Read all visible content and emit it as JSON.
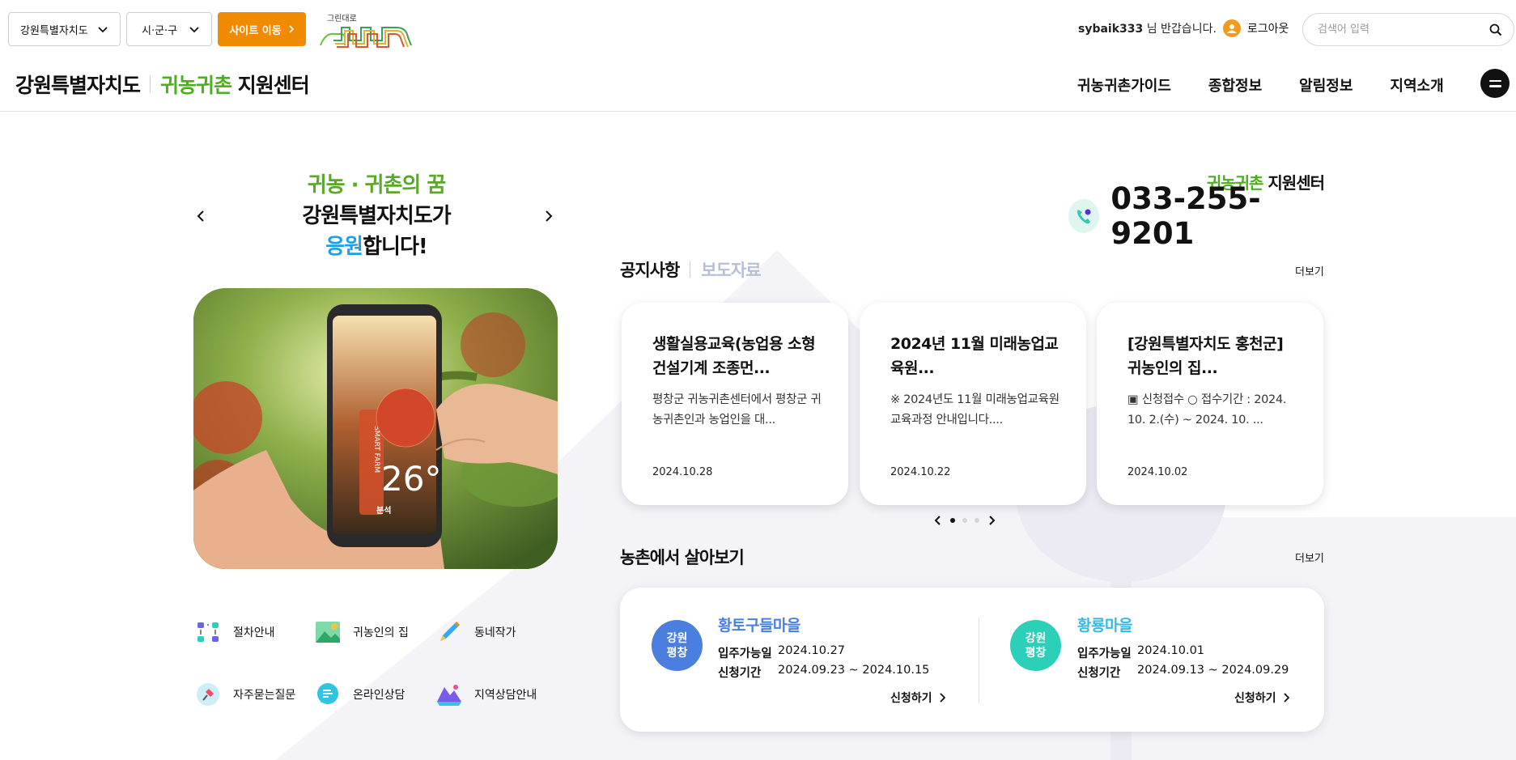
{
  "topbar": {
    "region_select": "강원특별자치도",
    "district_select": "시·군·구",
    "site_move_button": "사이트 이동",
    "greenroad_logo_text": "그린대로",
    "user_name": "sybaik333",
    "user_greeting": "님 반갑습니다.",
    "logout": "로그아웃",
    "search_placeholder": "검색어 입력"
  },
  "header": {
    "brand_region": "강원특별자치도",
    "brand_green": "귀농귀촌",
    "brand_rest": "지원센터",
    "nav": [
      "귀농귀촌가이드",
      "종합정보",
      "알림정보",
      "지역소개"
    ]
  },
  "hero": {
    "line1": "귀농 · 귀촌의 꿈",
    "line2": "강원특별자치도가",
    "line3_blue": "응원",
    "line3_rest": "합니다!",
    "image_label": "SMART FARM",
    "image_temp": "26°",
    "image_caption": "분석"
  },
  "quick_links": [
    "절차안내",
    "귀농인의 집",
    "동네작가",
    "자주묻는질문",
    "온라인상담",
    "지역상담안내"
  ],
  "contact": {
    "label_green": "귀농귀촌",
    "label_rest": "지원센터",
    "phone": "033-255-9201"
  },
  "notices": {
    "tab_active": "공지사항",
    "tab_inactive": "보도자료",
    "more": "더보기",
    "cards": [
      {
        "title": "생활실용교육(농업용 소형건설기계 조종먼...",
        "desc": "평창군 귀농귀촌센터에서 평창군 귀농귀촌인과 농업인을 대...",
        "date": "2024.10.28"
      },
      {
        "title": "2024년 11월 미래농업교육원...",
        "desc": "※ 2024년도 11월 미래농업교육원 교육과정 안내입니다....",
        "date": "2024.10.22"
      },
      {
        "title": "[강원특별자치도 홍천군] 귀농인의 집...",
        "desc": "▣ 신청접수 ○ 접수기간 : 2024. 10. 2.(수) ~ 2024. 10. ...",
        "date": "2024.10.02"
      }
    ]
  },
  "villages": {
    "title": "농촌에서 살아보기",
    "more": "더보기",
    "items": [
      {
        "badge_line1": "강원",
        "badge_line2": "평창",
        "name": "황토구들마을",
        "label_move": "입주가능일",
        "move_date": "2024.10.27",
        "label_period": "신청기간",
        "period": "2024.09.23 ~ 2024.10.15",
        "apply": "신청하기",
        "badge_color": "#4a7fe0",
        "name_color": "#4a7fe0"
      },
      {
        "badge_line1": "강원",
        "badge_line2": "평창",
        "name": "황룡마을",
        "label_move": "입주가능일",
        "move_date": "2024.10.01",
        "label_period": "신청기간",
        "period": "2024.09.13 ~ 2024.09.29",
        "apply": "신청하기",
        "badge_color": "#2ccfb8",
        "name_color": "#37b8e0"
      }
    ]
  }
}
